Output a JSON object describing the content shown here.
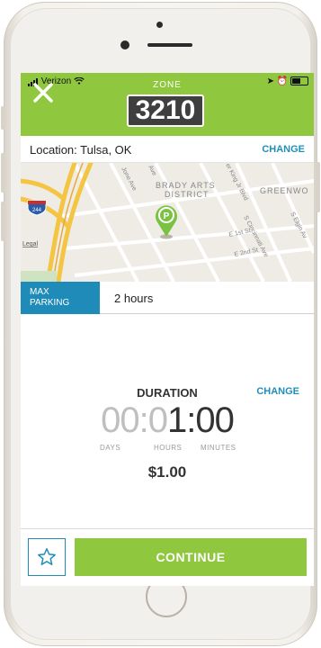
{
  "status_bar": {
    "carrier": "Verizon"
  },
  "header": {
    "zone_label": "ZONE",
    "zone_number": "3210"
  },
  "location": {
    "text": "Location: Tulsa, OK",
    "change_label": "CHANGE"
  },
  "map": {
    "labels": {
      "brady_arts": "BRADY ARTS",
      "district": "DISTRICT",
      "greenwood": "GREENWO",
      "jones_ave": "Jone Ave",
      "mlk_blvd": "er King Jr Blvd",
      "cincinnati": "S Cincinnati Ave",
      "e_1st": "E 1st St",
      "e_2nd": "E 2nd St",
      "elgin": "S Elgin Av",
      "ave": "Ave",
      "highway": "244",
      "legal": "Legal"
    }
  },
  "max_parking": {
    "label_line1": "MAX",
    "label_line2": "PARKING",
    "value": "2 hours"
  },
  "duration": {
    "title": "DURATION",
    "change_label": "CHANGE",
    "inactive_part": "00:0",
    "active_part": "1:00",
    "units": {
      "days": "DAYS",
      "hours": "HOURS",
      "minutes": "MINUTES"
    }
  },
  "price": "$1.00",
  "actions": {
    "continue_label": "CONTINUE"
  },
  "colors": {
    "brand_green": "#8fc83f",
    "accent_blue": "#1e8bb8",
    "zone_box": "#3f3f3f"
  },
  "icons": [
    "close-icon",
    "map-pin-icon",
    "star-icon",
    "wifi-icon",
    "battery-icon",
    "highway-shield-icon"
  ]
}
